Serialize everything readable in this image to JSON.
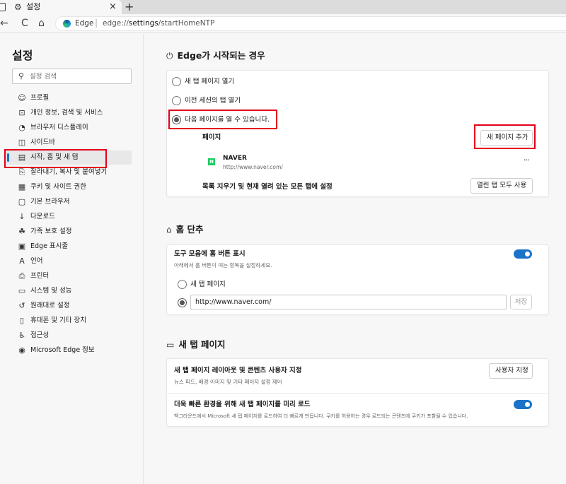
{
  "tab": {
    "title": "설정",
    "close": "×",
    "new_tab": "+"
  },
  "address_bar": {
    "site": "Edge",
    "separator": "|",
    "url_prefix": "edge://",
    "url_bold": "settings",
    "url_rest": "/startHomeNTP"
  },
  "icons": {
    "back": "←",
    "refresh": "C",
    "home": "⌂",
    "gear": "⚙",
    "search": "⚲"
  },
  "sidebar": {
    "title": "설정",
    "search_placeholder": "설정 검색",
    "items": [
      {
        "label": "프로필",
        "icon": "☺"
      },
      {
        "label": "개인 정보, 검색 및 서비스",
        "icon": "⊡"
      },
      {
        "label": "브라우저 디스플레이",
        "icon": "◔"
      },
      {
        "label": "사이드바",
        "icon": "◫"
      },
      {
        "label": "시작, 홈 및 새 탭",
        "icon": "▤"
      },
      {
        "label": "잘라내기, 복사 및 붙여넣기",
        "icon": "⎘"
      },
      {
        "label": "쿠키 및 사이트 권한",
        "icon": "▦"
      },
      {
        "label": "기본 브라우저",
        "icon": "▢"
      },
      {
        "label": "다운로드",
        "icon": "↓"
      },
      {
        "label": "가족 보호 설정",
        "icon": "☘"
      },
      {
        "label": "Edge 표시줄",
        "icon": "▣"
      },
      {
        "label": "언어",
        "icon": "A"
      },
      {
        "label": "프린터",
        "icon": "⎙"
      },
      {
        "label": "시스템 및 성능",
        "icon": "▭"
      },
      {
        "label": "원래대로 설정",
        "icon": "↺"
      },
      {
        "label": "휴대폰 및 기타 장치",
        "icon": "▯"
      },
      {
        "label": "접근성",
        "icon": "♿"
      },
      {
        "label": "Microsoft Edge 정보",
        "icon": "◉"
      }
    ],
    "active_index": 4
  },
  "startup": {
    "title": "Edge가 시작되는 경우",
    "icon": "⏻",
    "options": [
      "새 탭 페이지 열기",
      "이전 세션의 탭 열기",
      "다음 페이지를 열 수 있습니다."
    ],
    "selected_index": 2,
    "pages_label": "페이지",
    "add_page_button": "새 페이지 추가",
    "page_entry": {
      "name": "NAVER",
      "url": "http://www.naver.com/",
      "favicon": "N",
      "more": "···"
    },
    "clear_label": "목록 지우기 및 현재 열려 있는 모든 탭에 설정",
    "use_open_tabs_button": "열린 탭 모두 사용"
  },
  "home_button": {
    "title": "홈 단추",
    "icon": "⌂",
    "show_label": "도구 모음에 홈 버튼 표시",
    "show_desc": "아래에서 홈 버튼이 여는 항목을 설정하세요.",
    "toggle_on": true,
    "options": [
      "새 탭 페이지"
    ],
    "url_value": "http://www.naver.com/",
    "save_button": "저장"
  },
  "new_tab": {
    "title": "새 탭 페이지",
    "icon": "▭",
    "customize_label": "새 탭 페이지 레이아웃 및 콘텐츠 사용자 지정",
    "customize_desc": "뉴스 피드, 배경 이미지 및 기타 페이지 설정 제어",
    "customize_button": "사용자 지정",
    "preload_label": "더욱 빠른 환경을 위해 새 탭 페이지를 미리 로드",
    "preload_desc": "백그라운드에서 Microsoft 새 탭 페이지를 로드하여 더 빠르게 만듭니다. 쿠키를 허용하는 경우 로드되는 콘텐츠에 쿠키가 포함될 수 있습니다.",
    "preload_on": true
  }
}
